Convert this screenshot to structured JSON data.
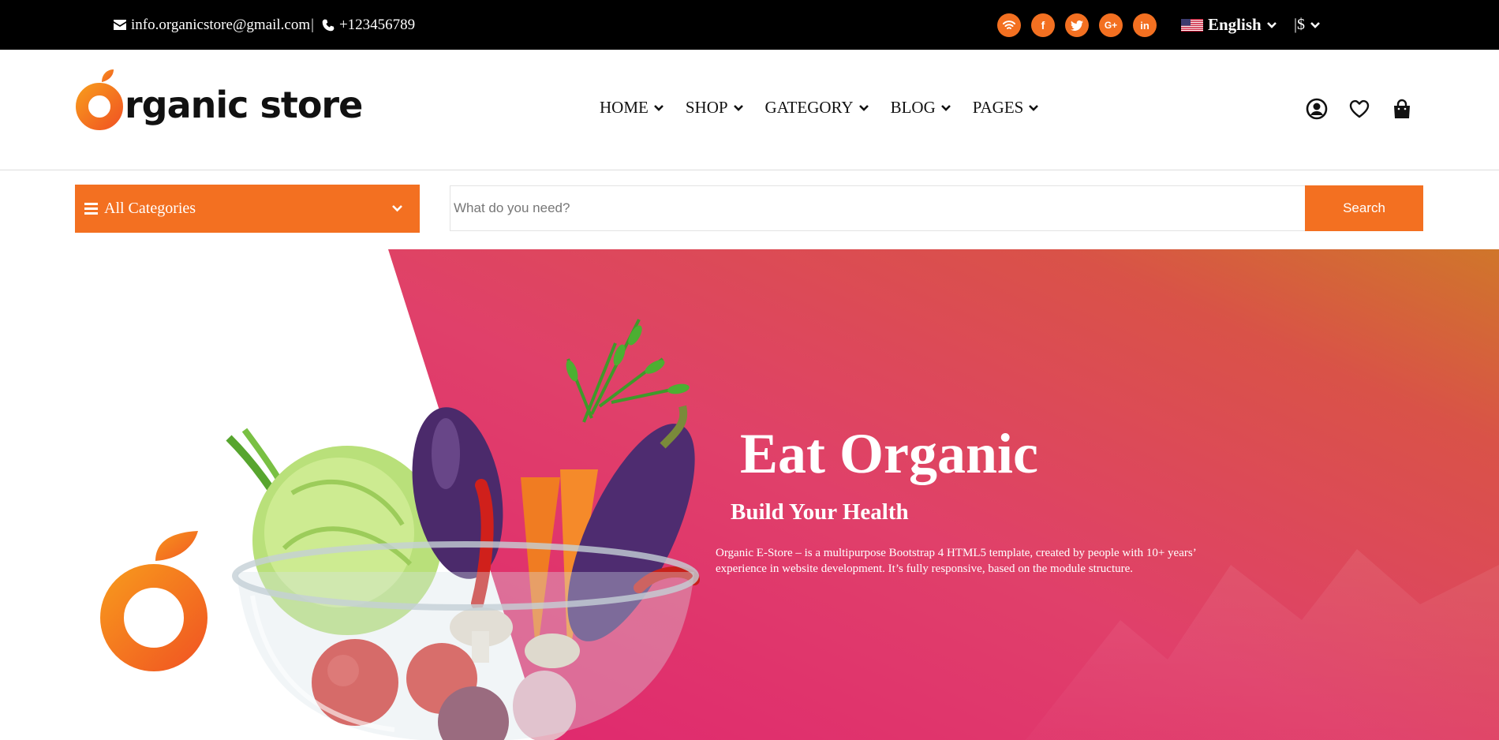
{
  "topbar": {
    "email": "info.organicstore@gmail.com",
    "separator": "|",
    "phone": "+123456789",
    "social": [
      {
        "icon": "wifi-icon",
        "label": ""
      },
      {
        "icon": "facebook-icon",
        "label": "f"
      },
      {
        "icon": "twitter-icon",
        "label": ""
      },
      {
        "icon": "google-plus-icon",
        "label": "G+"
      },
      {
        "icon": "linkedin-icon",
        "label": "in"
      }
    ],
    "language": "English",
    "currency": "|$"
  },
  "header": {
    "logo_text": "rganic store",
    "nav": [
      {
        "label": "HOME"
      },
      {
        "label": "SHOP"
      },
      {
        "label": "GATEGORY"
      },
      {
        "label": "BLOG"
      },
      {
        "label": "PAGES"
      }
    ],
    "icons": [
      "user-icon",
      "heart-icon",
      "shopping-bag-icon"
    ]
  },
  "searchbar": {
    "categories_label": "All Categories",
    "placeholder": "What do you need?",
    "button_label": "Search"
  },
  "hero": {
    "title": "Eat Organic",
    "subtitle": "Build Your Health",
    "description": "Organic E-Store – is a multipurpose Bootstrap 4 HTML5 template, created by people with 10+ years’ experience in website development. It’s fully responsive, based on the module structure."
  },
  "colors": {
    "accent": "#f37021",
    "topbar_bg": "#000000",
    "hero_pink": "#e0336e",
    "hero_orange": "#d86a3a"
  }
}
